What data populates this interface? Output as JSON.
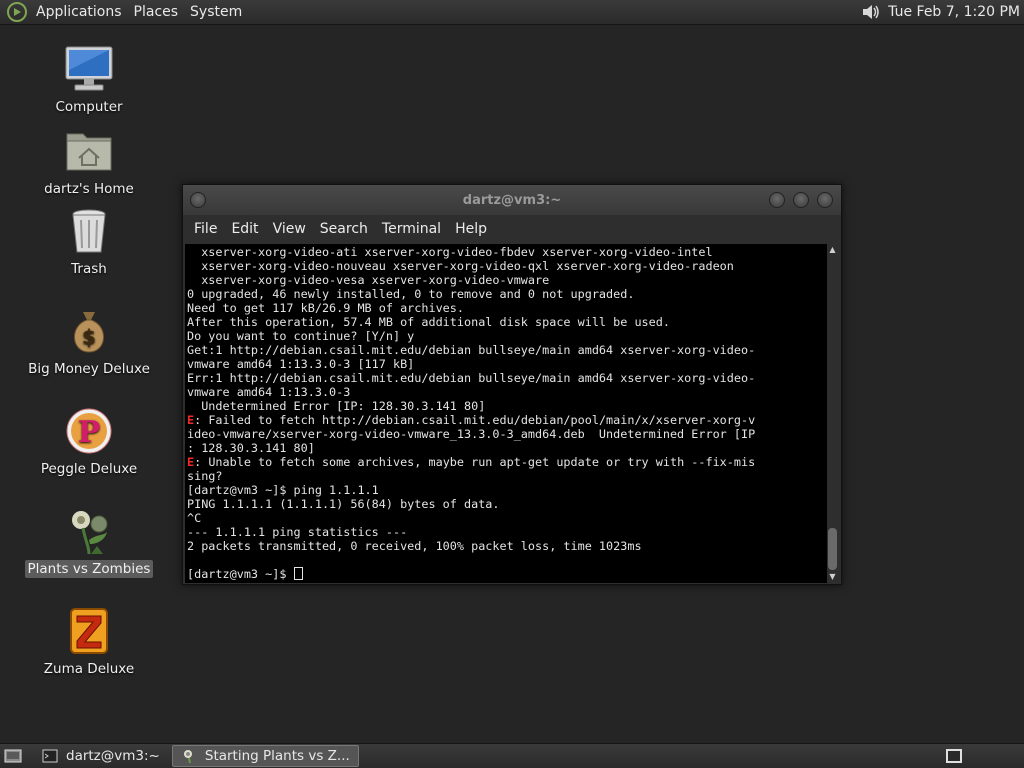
{
  "top_panel": {
    "menus": [
      "Applications",
      "Places",
      "System"
    ],
    "clock": "Tue Feb  7, 1:20 PM",
    "icons": {
      "logo": "gnome-foot-icon",
      "volume": "volume-icon"
    }
  },
  "desktop": {
    "icons": [
      {
        "label": "Computer",
        "icon": "computer-icon"
      },
      {
        "label": "dartz's Home",
        "icon": "home-folder-icon"
      },
      {
        "label": "Trash",
        "icon": "trash-icon"
      },
      {
        "label": "Big Money Deluxe",
        "icon": "money-bag-icon"
      },
      {
        "label": "Peggle Deluxe",
        "icon": "peggle-icon"
      },
      {
        "label": "Plants vs Zombies",
        "icon": "plants-vs-zombies-icon",
        "selected": true
      },
      {
        "label": "Zuma Deluxe",
        "icon": "zuma-icon"
      }
    ]
  },
  "terminal": {
    "title": "dartz@vm3:~",
    "menus": [
      "File",
      "Edit",
      "View",
      "Search",
      "Terminal",
      "Help"
    ],
    "lines": [
      "  xserver-xorg-video-ati xserver-xorg-video-fbdev xserver-xorg-video-intel",
      "  xserver-xorg-video-nouveau xserver-xorg-video-qxl xserver-xorg-video-radeon",
      "  xserver-xorg-video-vesa xserver-xorg-video-vmware",
      "0 upgraded, 46 newly installed, 0 to remove and 0 not upgraded.",
      "Need to get 117 kB/26.9 MB of archives.",
      "After this operation, 57.4 MB of additional disk space will be used.",
      "Do you want to continue? [Y/n] y",
      "Get:1 http://debian.csail.mit.edu/debian bullseye/main amd64 xserver-xorg-video-",
      "vmware amd64 1:13.3.0-3 [117 kB]",
      "Err:1 http://debian.csail.mit.edu/debian bullseye/main amd64 xserver-xorg-video-",
      "vmware amd64 1:13.3.0-3",
      "  Undetermined Error [IP: 128.30.3.141 80]",
      "E: Failed to fetch http://debian.csail.mit.edu/debian/pool/main/x/xserver-xorg-v",
      "ideo-vmware/xserver-xorg-video-vmware_13.3.0-3_amd64.deb  Undetermined Error [IP",
      ": 128.30.3.141 80]",
      "E: Unable to fetch some archives, maybe run apt-get update or try with --fix-mis",
      "sing?",
      "[dartz@vm3 ~]$ ping 1.1.1.1",
      "PING 1.1.1.1 (1.1.1.1) 56(84) bytes of data.",
      "^C",
      "--- 1.1.1.1 ping statistics ---",
      "2 packets transmitted, 0 received, 100% packet loss, time 1023ms",
      "",
      "[dartz@vm3 ~]$ "
    ],
    "error_prefix": "E",
    "colors": {
      "background": "#000000",
      "foreground": "#e4e4e4",
      "error": "#ef2929"
    }
  },
  "bottom_panel": {
    "tasks": [
      {
        "label": "dartz@vm3:~",
        "icon": "terminal-icon",
        "active": false
      },
      {
        "label": "Starting Plants vs Z...",
        "icon": "plants-vs-zombies-icon",
        "active": true
      }
    ],
    "icons": {
      "show_desktop": "show-desktop-icon",
      "workspace": "workspace-switcher-icon"
    }
  }
}
